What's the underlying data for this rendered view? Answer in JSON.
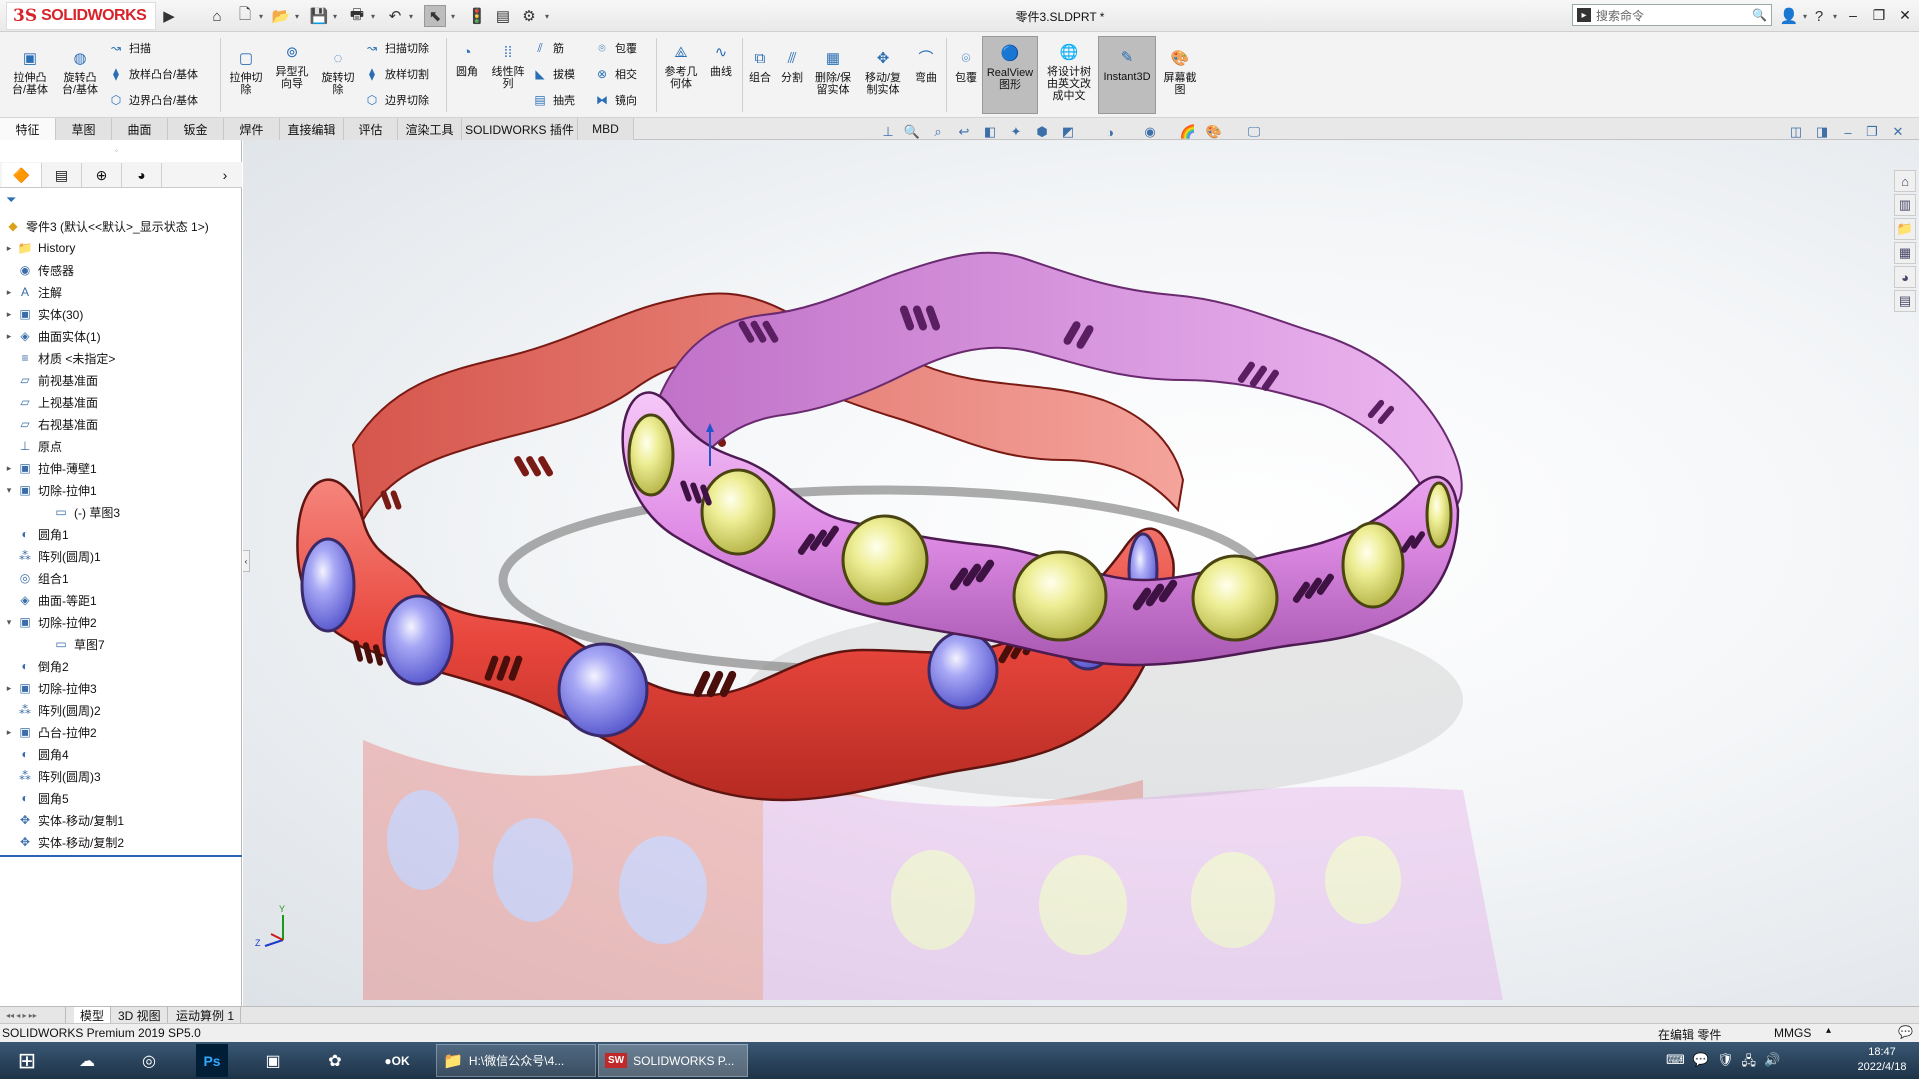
{
  "app": {
    "logo_ds": "3S",
    "logo_text": "SOLIDWORKS",
    "document_title": "零件3.SLDPRT *",
    "search_placeholder": "搜索命令"
  },
  "ribbon": {
    "extrude_boss": "拉伸凸\n台/基体",
    "revolve_boss": "旋转凸\n台/基体",
    "sweep": "扫描",
    "loft_boss": "放样凸台/基体",
    "boundary_boss": "边界凸台/基体",
    "extrude_cut": "拉伸切\n除",
    "hole_wizard": "异型孔\n向导",
    "revolve_cut": "旋转切\n除",
    "sweep_cut": "扫描切除",
    "loft_cut": "放样切割",
    "boundary_cut": "边界切除",
    "fillet": "圆角",
    "linear_pattern": "线性阵\n列",
    "rib": "筋",
    "draft": "拔模",
    "shell": "抽壳",
    "wrap": "包覆",
    "intersect": "相交",
    "mirror": "镜向",
    "ref_geometry": "参考几\n何体",
    "curves": "曲线",
    "combine": "组合",
    "split": "分割",
    "delete_keep_body": "删除/保\n留实体",
    "move_copy_body": "移动/复\n制实体",
    "flex": "弯曲",
    "wrap2": "包覆",
    "realview": "RealView\n图形",
    "translate_tree": "将设计树\n由英文改\n成中文",
    "instant3d": "Instant3D",
    "screen_capture": "屏幕截\n图"
  },
  "tabs": [
    "特征",
    "草图",
    "曲面",
    "钣金",
    "焊件",
    "直接编辑",
    "评估",
    "渲染工具",
    "SOLIDWORKS 插件",
    "MBD"
  ],
  "tree": {
    "root": "零件3 (默认<<默认>_显示状态 1>)",
    "items": [
      {
        "label": "History",
        "exp": "▸",
        "icon": "📁"
      },
      {
        "label": "传感器",
        "exp": "",
        "icon": "◉"
      },
      {
        "label": "注解",
        "exp": "▸",
        "icon": "A"
      },
      {
        "label": "实体(30)",
        "exp": "▸",
        "icon": "▣"
      },
      {
        "label": "曲面实体(1)",
        "exp": "▸",
        "icon": "◈"
      },
      {
        "label": "材质 <未指定>",
        "exp": "",
        "icon": "≡"
      },
      {
        "label": "前视基准面",
        "exp": "",
        "icon": "▱"
      },
      {
        "label": "上视基准面",
        "exp": "",
        "icon": "▱"
      },
      {
        "label": "右视基准面",
        "exp": "",
        "icon": "▱"
      },
      {
        "label": "原点",
        "exp": "",
        "icon": "⊥"
      },
      {
        "label": "拉伸-薄壁1",
        "exp": "▸",
        "icon": "▣"
      },
      {
        "label": "切除-拉伸1",
        "exp": "▾",
        "icon": "▣"
      },
      {
        "label": "(-) 草图3",
        "exp": "",
        "icon": "▭",
        "indent": true
      },
      {
        "label": "圆角1",
        "exp": "",
        "icon": "◐"
      },
      {
        "label": "阵列(圆周)1",
        "exp": "",
        "icon": "⁂"
      },
      {
        "label": "组合1",
        "exp": "",
        "icon": "◎"
      },
      {
        "label": "曲面-等距1",
        "exp": "",
        "icon": "◈"
      },
      {
        "label": "切除-拉伸2",
        "exp": "▾",
        "icon": "▣"
      },
      {
        "label": "草图7",
        "exp": "",
        "icon": "▭",
        "indent": true
      },
      {
        "label": "倒角2",
        "exp": "",
        "icon": "◐"
      },
      {
        "label": "切除-拉伸3",
        "exp": "▸",
        "icon": "▣"
      },
      {
        "label": "阵列(圆周)2",
        "exp": "",
        "icon": "⁂"
      },
      {
        "label": "凸台-拉伸2",
        "exp": "▸",
        "icon": "▣"
      },
      {
        "label": "圆角4",
        "exp": "",
        "icon": "◐"
      },
      {
        "label": "阵列(圆周)3",
        "exp": "",
        "icon": "⁂"
      },
      {
        "label": "圆角5",
        "exp": "",
        "icon": "◐"
      },
      {
        "label": "实体-移动/复制1",
        "exp": "",
        "icon": "✥"
      },
      {
        "label": "实体-移动/复制2",
        "exp": "",
        "icon": "✥"
      }
    ]
  },
  "bottom_tabs": [
    "模型",
    "3D 视图",
    "运动算例 1"
  ],
  "status": {
    "product": "SOLIDWORKS Premium 2019 SP5.0",
    "mode": "在编辑 零件",
    "units": "MMGS"
  },
  "taskbar": {
    "folder_window": "H:\\微信公众号\\4...",
    "sw_window": "SOLIDWORKS P...",
    "time": "18:47",
    "date": "2022/4/18"
  },
  "colors": {
    "red_bangle": "#e8463c",
    "pink_bangle": "#e08ee6",
    "blue_gem": "#8c8cf0",
    "yellow_gem": "#ecec8c",
    "accent": "#d8232a"
  }
}
